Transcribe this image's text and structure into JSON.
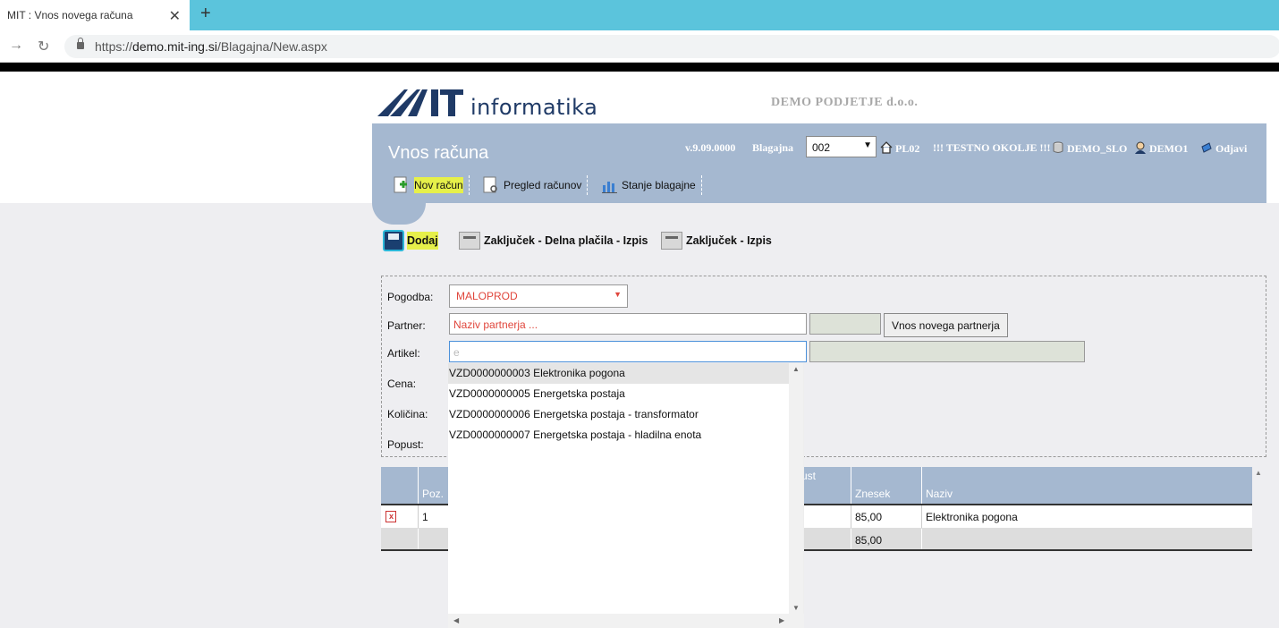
{
  "browser": {
    "tab_title": "MIT : Vnos novega računa",
    "close": "✕",
    "new_tab": "+",
    "back": "→",
    "reload": "↻",
    "url_prefix": "https://",
    "url_domain": "demo.mit-ing.si",
    "url_path": "/Blagajna/New.aspx"
  },
  "brand": {
    "logo_word": "informatika",
    "company": "DEMO PODJETJE d.o.o."
  },
  "header": {
    "title": "Vnos računa",
    "version": "v.9.09.0000",
    "blagajna_label": "Blagajna",
    "blagajna_value": "002",
    "location": "PL02",
    "env": "!!! TESTNO OKOLJE !!!",
    "db": "DEMO_SLO",
    "user": "DEMO1",
    "logout": "Odjavi",
    "toolbar": [
      {
        "label": "Nov račun"
      },
      {
        "label": "Pregled računov"
      },
      {
        "label": "Stanje blagajne"
      }
    ]
  },
  "actions": {
    "add": "Dodaj",
    "close_partial": "Zaključek - Delna plačila - Izpis",
    "close_print": "Zaključek - Izpis"
  },
  "form": {
    "pogodba_label": "Pogodba:",
    "pogodba_value": "MALOPROD",
    "partner_label": "Partner:",
    "partner_placeholder": "Naziv partnerja ...",
    "new_partner_button": "Vnos novega partnerja",
    "artikel_label": "Artikel:",
    "artikel_value": "e",
    "cena_label": "Cena:",
    "kolicina_label": "Količina:",
    "popust_label": "Popust:"
  },
  "autocomplete": [
    "VZD0000000003 Elektronika pogona",
    "VZD0000000005 Energetska postaja",
    "VZD0000000006 Energetska postaja - transformator",
    "VZD0000000007 Energetska postaja - hladilna enota"
  ],
  "grid": {
    "headers": {
      "poz": "Poz.",
      "popust_partial": "ust",
      "znesek": "Znesek",
      "naziv": "Naziv"
    },
    "rows": [
      {
        "poz": "1",
        "znesek": "85,00",
        "naziv": "Elektronika pogona"
      }
    ],
    "total": "85,00"
  }
}
